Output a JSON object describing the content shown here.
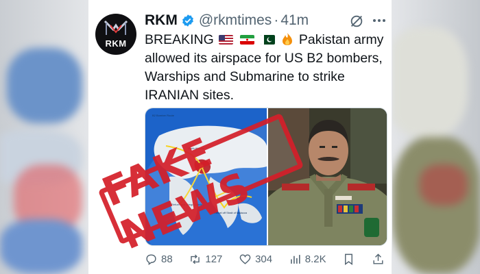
{
  "author": {
    "name": "RKM",
    "handle": "@rkmtimes",
    "separator": "·",
    "time": "41m",
    "avatar_text": "RKM"
  },
  "tweet": {
    "prefix": "BREAKING",
    "text": "Pakistan army allowed its airspace for US B2 bombers, Warships and Submarine to strike IRANIAN sites."
  },
  "media": {
    "map_title": "B2 Bomber Route",
    "map_labels": {
      "label_1": "North Atlantic",
      "label_2": "Refuel near Diego Garcia",
      "label_3": "Refuel off Strait of Malacca"
    }
  },
  "stamp": {
    "text": "FAKE NEWS"
  },
  "actions": {
    "replies": "88",
    "reposts": "127",
    "likes": "304",
    "views": "8.2K"
  },
  "colors": {
    "verified": "#1d9bf0",
    "stamp": "#d4202a",
    "muted": "#536471",
    "text": "#0f1419"
  },
  "icons": {
    "verified": "verified-badge-icon",
    "grok": "grok-icon",
    "more": "more-icon",
    "reply": "reply-icon",
    "repost": "repost-icon",
    "like": "heart-icon",
    "views": "views-icon",
    "bookmark": "bookmark-icon",
    "share": "share-icon"
  }
}
